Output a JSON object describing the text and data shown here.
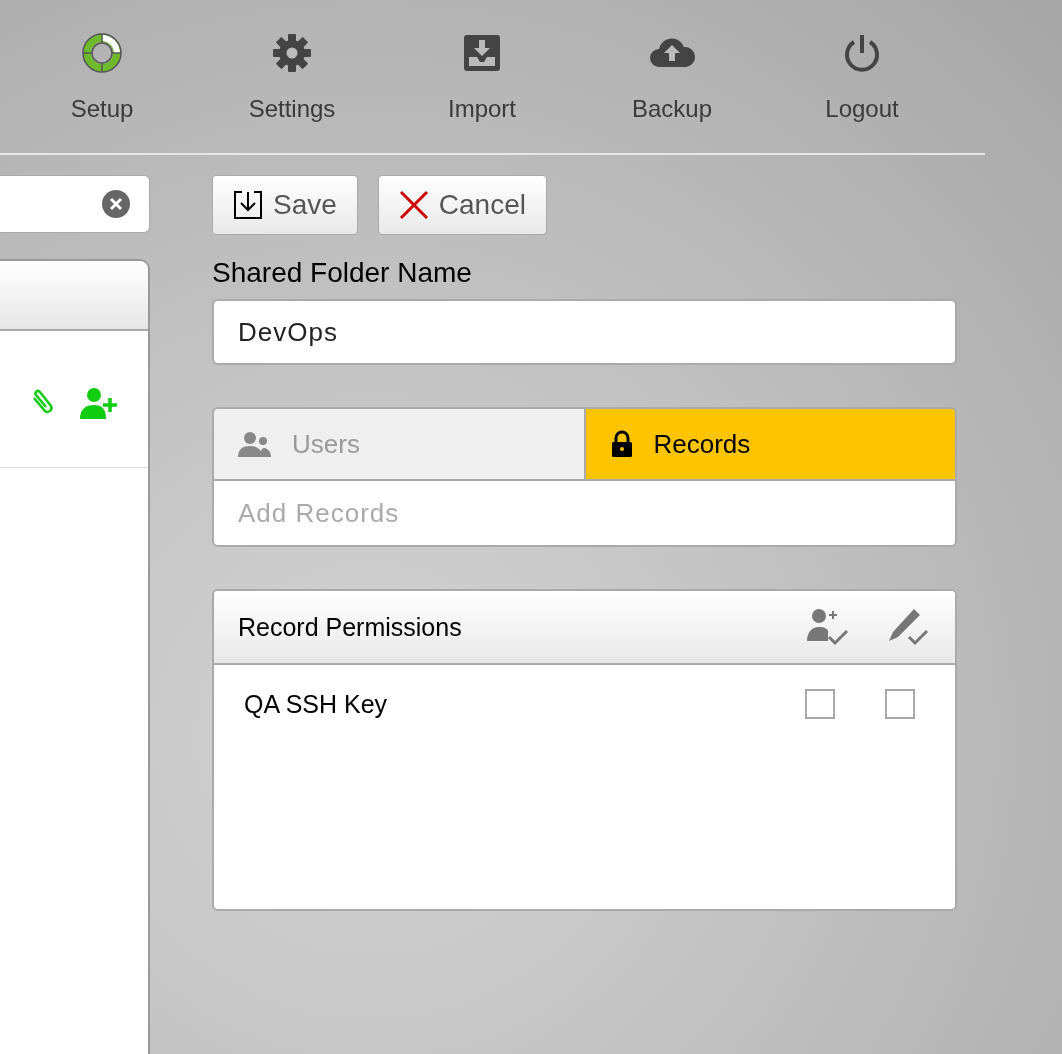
{
  "nav": [
    {
      "label": "Setup",
      "kind": "setup"
    },
    {
      "label": "Settings",
      "kind": "gear"
    },
    {
      "label": "Import",
      "kind": "import"
    },
    {
      "label": "Backup",
      "kind": "cloud"
    },
    {
      "label": "Logout",
      "kind": "power"
    }
  ],
  "toolbar": {
    "save": "Save",
    "cancel": "Cancel"
  },
  "folder_name": {
    "label": "Shared Folder Name",
    "value": "DevOps"
  },
  "tabs": [
    {
      "label": "Users",
      "kind": "users",
      "selected": false
    },
    {
      "label": "Records",
      "kind": "lock",
      "selected": true
    }
  ],
  "add_field": {
    "placeholder": "Add Records"
  },
  "permissions": {
    "title": "Record Permissions",
    "rows": [
      {
        "name": "QA SSH Key",
        "can_share": false,
        "can_edit": false
      }
    ]
  }
}
